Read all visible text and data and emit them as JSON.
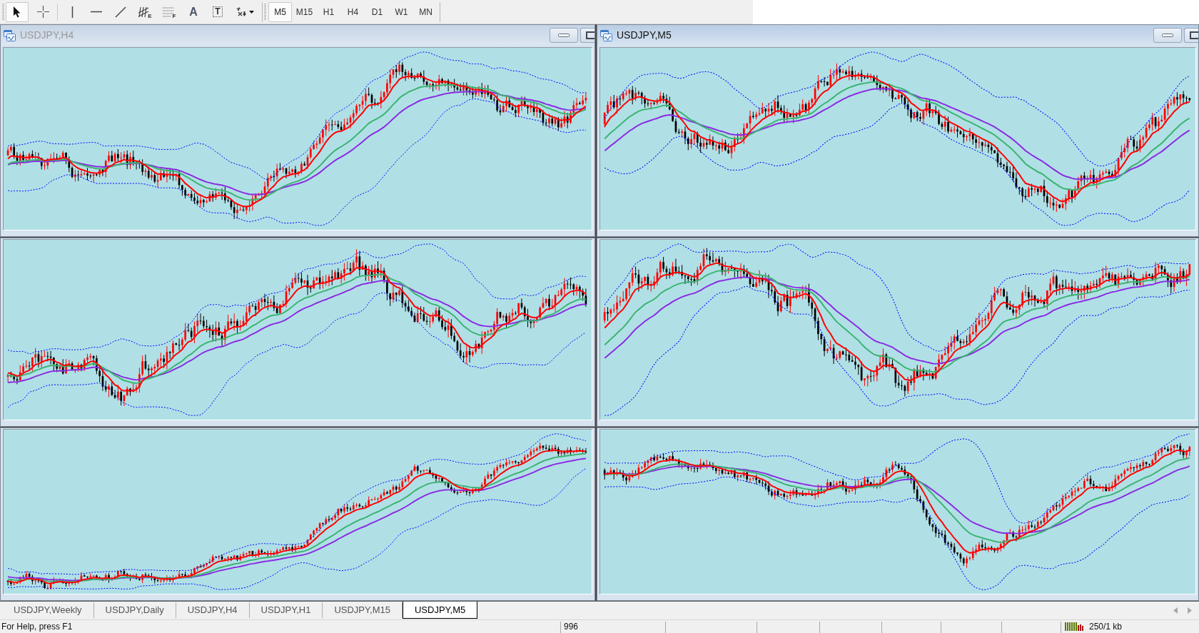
{
  "toolbar": {
    "tools": [
      {
        "kind": "cursor",
        "selected": true
      },
      {
        "kind": "crosshair",
        "selected": false
      },
      {
        "kind": "vertical-line",
        "selected": false
      },
      {
        "kind": "horizontal-line",
        "selected": false
      },
      {
        "kind": "trendline",
        "selected": false
      },
      {
        "kind": "channel",
        "selected": false,
        "letter": "E"
      },
      {
        "kind": "fibo",
        "selected": false,
        "letter": "F"
      },
      {
        "kind": "text",
        "selected": false,
        "letter": "A"
      },
      {
        "kind": "label",
        "selected": false,
        "letter": "T"
      },
      {
        "kind": "arrows",
        "selected": false
      }
    ],
    "periods": [
      {
        "label": "M5",
        "selected": true
      },
      {
        "label": "M15",
        "selected": false
      },
      {
        "label": "H1",
        "selected": false
      },
      {
        "label": "H4",
        "selected": false
      },
      {
        "label": "D1",
        "selected": false
      },
      {
        "label": "W1",
        "selected": false
      },
      {
        "label": "MN",
        "selected": false
      }
    ]
  },
  "windows": [
    {
      "title": "USDJPY,H4",
      "active": false,
      "kind": "candlestick"
    },
    {
      "title": "USDJPY,M5",
      "active": true,
      "kind": "candlestick"
    },
    {
      "kind": "candlestick"
    },
    {
      "kind": "candlestick"
    },
    {
      "kind": "candlestick"
    },
    {
      "kind": "candlestick"
    }
  ],
  "tabs": [
    {
      "label": "USDJPY,Weekly",
      "selected": false
    },
    {
      "label": "USDJPY,Daily",
      "selected": false
    },
    {
      "label": "USDJPY,H4",
      "selected": false
    },
    {
      "label": "USDJPY,H1",
      "selected": false
    },
    {
      "label": "USDJPY,M15",
      "selected": false
    },
    {
      "label": "USDJPY,M5",
      "selected": true
    }
  ],
  "status_bar": {
    "help_text": "For Help, press F1",
    "section_2": "996",
    "traffic": "250/1 kb"
  }
}
